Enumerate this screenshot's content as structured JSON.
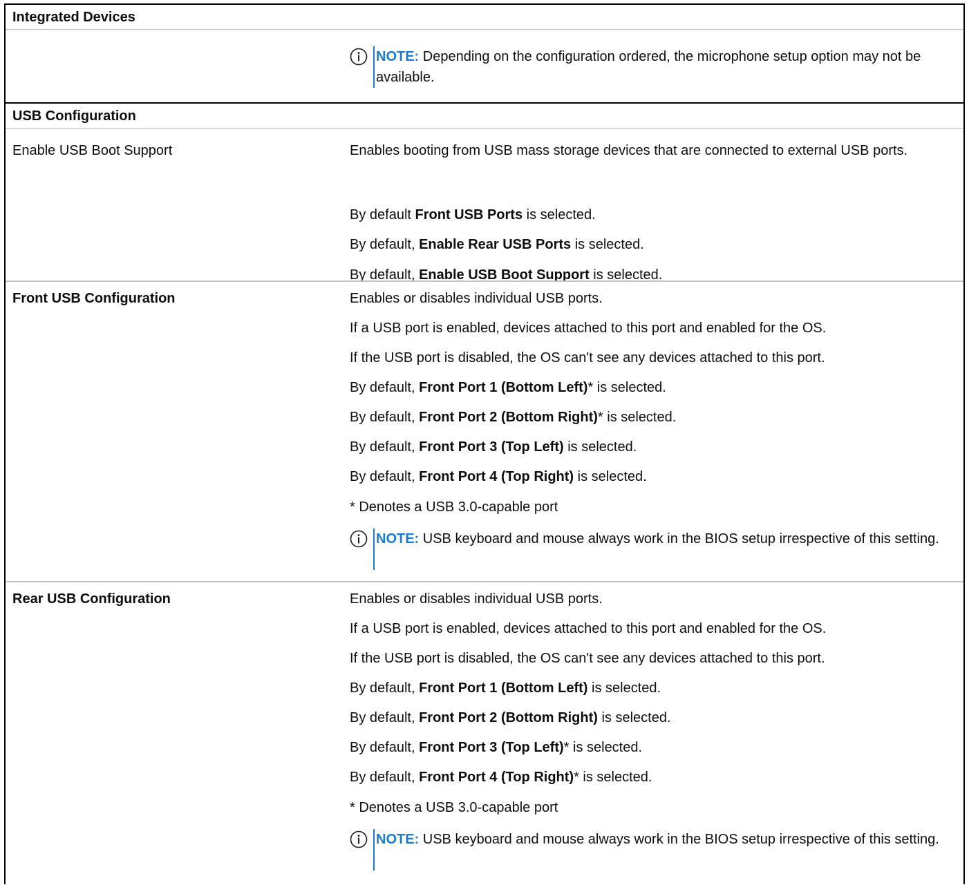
{
  "sections": {
    "integrated_devices": "Integrated Devices",
    "usb_configuration": "USB Configuration"
  },
  "top_note": {
    "tag": "NOTE:",
    "text": " Depending on the configuration ordered, the microphone setup option may not be available."
  },
  "enable_usb_boot": {
    "label": "Enable USB Boot Support",
    "line1": "Enables booting from USB mass storage devices that are connected to external USB ports.",
    "l2_pre": "By default ",
    "l2_b": "Front USB Ports",
    "l2_post": " is selected.",
    "l3_pre": "By default, ",
    "l3_b": "Enable Rear USB Ports",
    "l3_post": " is selected.",
    "l4_pre": "By default, ",
    "l4_b": "Enable USB Boot Support",
    "l4_post": " is selected."
  },
  "front_usb": {
    "label": "Front USB Configuration",
    "line1": "Enables or disables individual USB ports.",
    "line2": "If a USB port is enabled, devices attached to this port and enabled for the OS.",
    "line3": "If the USB port is disabled, the OS can't see any devices attached to this port.",
    "p1_pre": "By default, ",
    "p1_b": "Front Port 1 (Bottom Left)",
    "p1_post": "* is selected.",
    "p2_pre": "By default, ",
    "p2_b": "Front Port 2 (Bottom Right)",
    "p2_post": "* is selected.",
    "p3_pre": "By default, ",
    "p3_b": "Front Port 3 (Top Left)",
    "p3_post": " is selected.",
    "p4_pre": "By default, ",
    "p4_b": "Front Port 4 (Top Right)",
    "p4_post": " is selected.",
    "footnote": "* Denotes a USB 3.0-capable port",
    "note_tag": "NOTE:",
    "note_text": " USB keyboard and mouse always work in the BIOS setup irrespective of this setting."
  },
  "rear_usb": {
    "label": "Rear USB Configuration",
    "line1": "Enables or disables individual USB ports.",
    "line2": "If a USB port is enabled, devices attached to this port and enabled for the OS.",
    "line3": "If the USB port is disabled, the OS can't see any devices attached to this port.",
    "p1_pre": "By default, ",
    "p1_b": "Front Port 1 (Bottom Left)",
    "p1_post": " is selected.",
    "p2_pre": "By default, ",
    "p2_b": "Front Port 2 (Bottom Right)",
    "p2_post": " is selected.",
    "p3_pre": "By default, ",
    "p3_b": "Front Port 3 (Top Left)",
    "p3_post": "* is selected.",
    "p4_pre": "By default, ",
    "p4_b": "Front Port 4 (Top Right)",
    "p4_post": "* is selected.",
    "footnote": "* Denotes a USB 3.0-capable port",
    "note_tag": "NOTE:",
    "note_text": " USB keyboard and mouse always work in the BIOS setup irrespective of this setting."
  },
  "colors": {
    "note_accent": "#1a7bd0",
    "table_border": "#000000",
    "row_divider": "#c4c4c4"
  },
  "icons": {
    "note": "info-circle-icon"
  }
}
